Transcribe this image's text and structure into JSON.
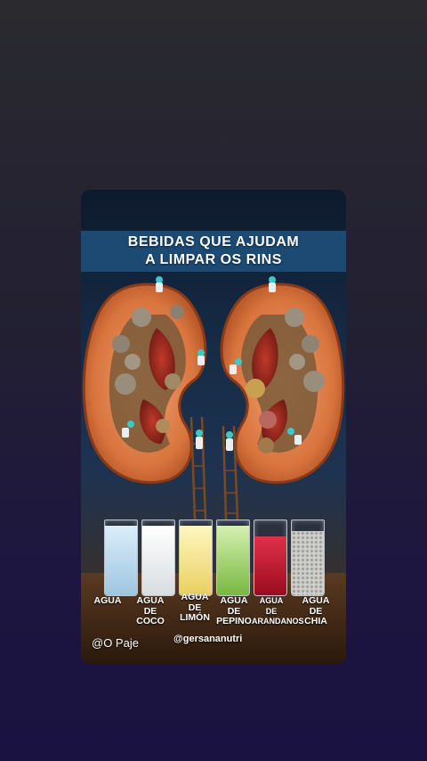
{
  "post": {
    "title_line1": "BEBIDAS QUE AJUDAM",
    "title_line2": "A LIMPAR OS RINS",
    "credit": "@O Paje",
    "handle": "@gersananutri"
  },
  "drinks": [
    {
      "line1": "AGUA",
      "line2": "",
      "line3": "",
      "color": "#cfe6f4"
    },
    {
      "line1": "AGUA",
      "line2": "DE",
      "line3": "COCO",
      "color": "#f4f4f2"
    },
    {
      "line1": "AGUA",
      "line2": "DE",
      "line3": "LIMÓN",
      "color": "#f2e060"
    },
    {
      "line1": "AGUA",
      "line2": "DE",
      "line3": "PEPINO",
      "color": "#a8d66a"
    },
    {
      "line1": "AGUA",
      "line2": "DE",
      "line3": "ARANDANOS",
      "color": "#c0142a"
    },
    {
      "line1": "AGUA",
      "line2": "DE",
      "line3": "CHIA",
      "color": "#b9b9b6"
    }
  ],
  "colors": {
    "title_band": "#1c4a73",
    "kidney": "#d9743e",
    "background": "#1d1640"
  }
}
